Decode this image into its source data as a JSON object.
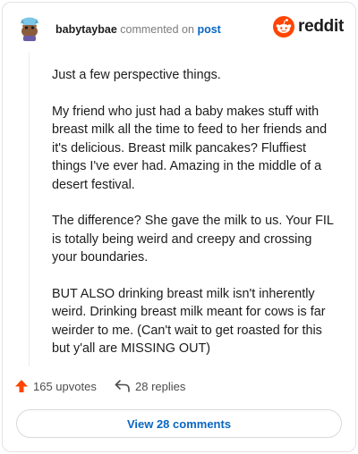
{
  "comment": {
    "username": "babytaybae",
    "action_text": "commented on",
    "post_link": "post",
    "paragraphs": [
      "Just a few perspective things.",
      "My friend who just had a baby makes stuff with breast milk all the time to feed to her friends and it's delicious. Breast milk pancakes? Fluffiest things I've ever had. Amazing in the middle of a desert festival.",
      "The difference? She gave the milk to us. Your FIL is totally being weird and creepy and crossing your boundaries.",
      "BUT ALSO drinking breast milk isn't inherently weird. Drinking breast milk meant for cows is far weirder to me. (Can't wait to get roasted for this but y'all are MISSING OUT)"
    ]
  },
  "brand": {
    "name": "reddit",
    "color": "#ff4500"
  },
  "actions": {
    "upvotes": "165 upvotes",
    "replies": "28 replies"
  },
  "view_button": "View 28 comments",
  "icons": {
    "avatar": "avatar-icon",
    "logo": "reddit-logo-icon",
    "upvote": "upvote-arrow-icon",
    "reply": "reply-arrow-icon"
  }
}
